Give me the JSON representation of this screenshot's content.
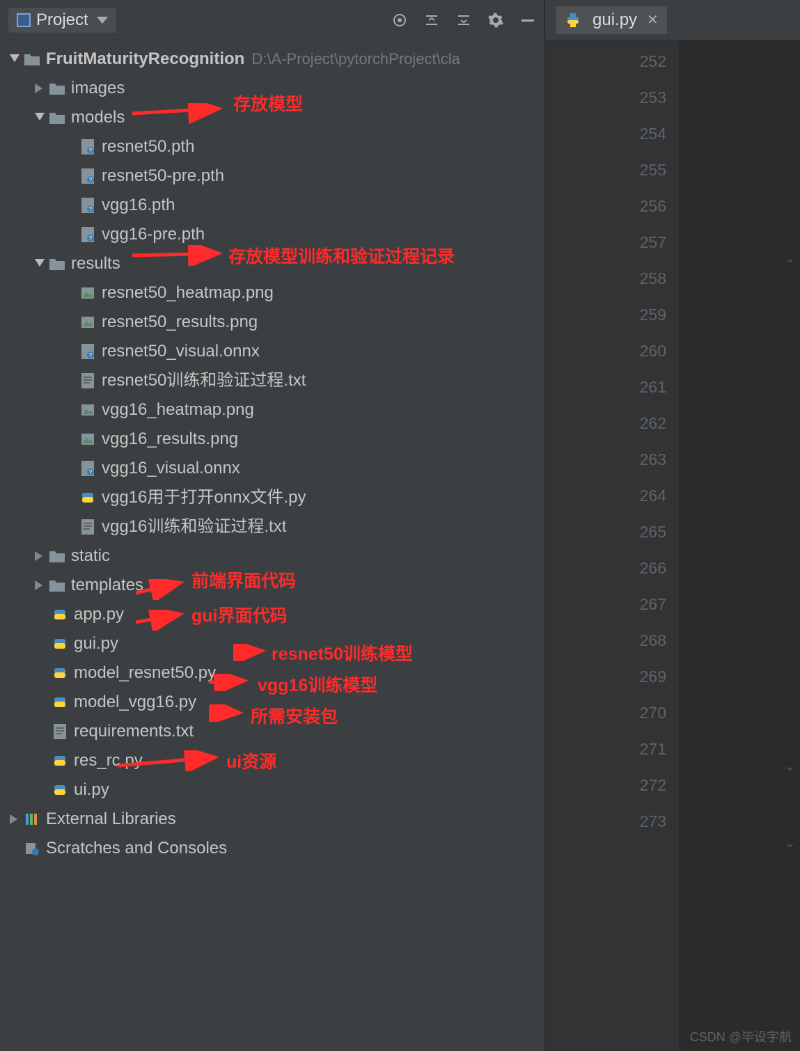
{
  "toolbar": {
    "project_label": "Project"
  },
  "tree": {
    "root": {
      "name": "FruitMaturityRecognition",
      "path": "D:\\A-Project\\pytorchProject\\cla"
    },
    "images": "images",
    "models": {
      "name": "models",
      "files": [
        "resnet50.pth",
        "resnet50-pre.pth",
        "vgg16.pth",
        "vgg16-pre.pth"
      ]
    },
    "results": {
      "name": "results",
      "files": [
        "resnet50_heatmap.png",
        "resnet50_results.png",
        "resnet50_visual.onnx",
        "resnet50训练和验证过程.txt",
        "vgg16_heatmap.png",
        "vgg16_results.png",
        "vgg16_visual.onnx",
        "vgg16用于打开onnx文件.py",
        "vgg16训练和验证过程.txt"
      ]
    },
    "static": "static",
    "templates": "templates",
    "root_files": [
      "app.py",
      "gui.py",
      "model_resnet50.py",
      "model_vgg16.py",
      "requirements.txt",
      "res_rc.py",
      "ui.py"
    ],
    "external": "External Libraries",
    "scratches": "Scratches and Consoles"
  },
  "tab": {
    "name": "gui.py"
  },
  "gutter": {
    "start": 252,
    "end": 273
  },
  "annotations": {
    "models": "存放模型",
    "results": "存放模型训练和验证过程记录",
    "app": "前端界面代码",
    "gui": "gui界面代码",
    "resnet": "resnet50训练模型",
    "vgg": "vgg16训练模型",
    "req": "所需安装包",
    "ui": "ui资源"
  },
  "watermark": "CSDN @毕设宇航"
}
